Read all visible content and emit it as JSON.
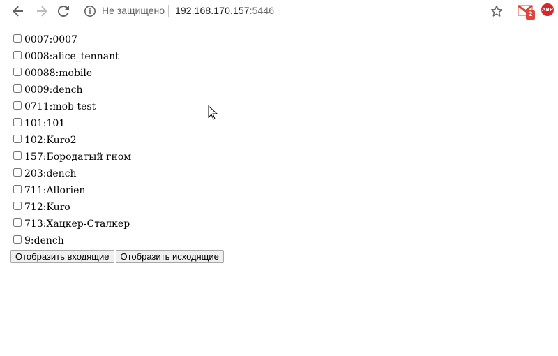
{
  "browser": {
    "security_label": "Не защищено",
    "url_host": "192.168.170.157",
    "url_port": ":5446",
    "gmail_badge": "2",
    "abp_label": "ABP",
    "icons": [
      "back-arrow-icon",
      "forward-arrow-icon",
      "reload-icon",
      "info-icon",
      "star-icon",
      "gmail-icon",
      "adblock-icon"
    ]
  },
  "items": [
    {
      "label": "0007:0007"
    },
    {
      "label": "0008:alice_tennant"
    },
    {
      "label": "00088:mobile"
    },
    {
      "label": "0009:dench"
    },
    {
      "label": "0711:mob test"
    },
    {
      "label": "101:101"
    },
    {
      "label": "102:Kuro2"
    },
    {
      "label": "157:Бородатый гном"
    },
    {
      "label": "203:dench"
    },
    {
      "label": "711:Allorien"
    },
    {
      "label": "712:Kuro"
    },
    {
      "label": "713:Хацкер-Сталкер"
    },
    {
      "label": "9:dench"
    }
  ],
  "actions": {
    "show_incoming": "Отобразить входящие",
    "show_outgoing": "Отобразить исходящие"
  }
}
